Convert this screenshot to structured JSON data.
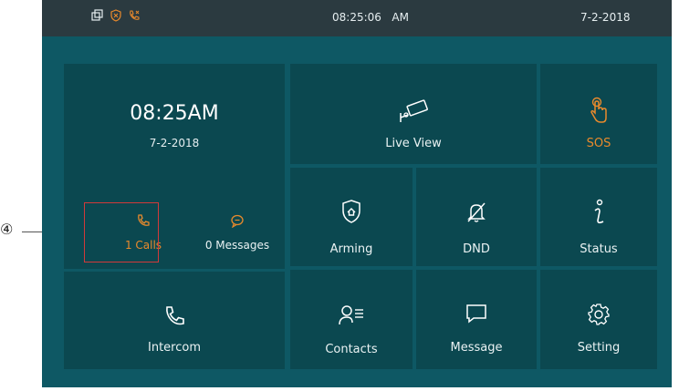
{
  "statusbar": {
    "time": "08:25:06",
    "ampm": "AM",
    "date": "7-2-2018",
    "icons": [
      "windows-icon",
      "shield-icon",
      "phone-missed-icon"
    ]
  },
  "home": {
    "clock": "08:25AM",
    "date": "7-2-2018",
    "calls_label": "1 Calls",
    "messages_label": "0 Messages",
    "intercom_label": "Intercom"
  },
  "tiles": {
    "live_view": "Live View",
    "sos": "SOS",
    "arming": "Arming",
    "dnd": "DND",
    "status": "Status",
    "contacts": "Contacts",
    "message": "Message",
    "setting": "Setting"
  },
  "annotation": {
    "callout_number": "④"
  },
  "colors": {
    "screen_bg": "#0e5864",
    "tile_bg": "#0b4850",
    "accent": "#e98a2c",
    "statusbar_bg": "#2b3a40",
    "highlight_box": "#d23a3a"
  }
}
